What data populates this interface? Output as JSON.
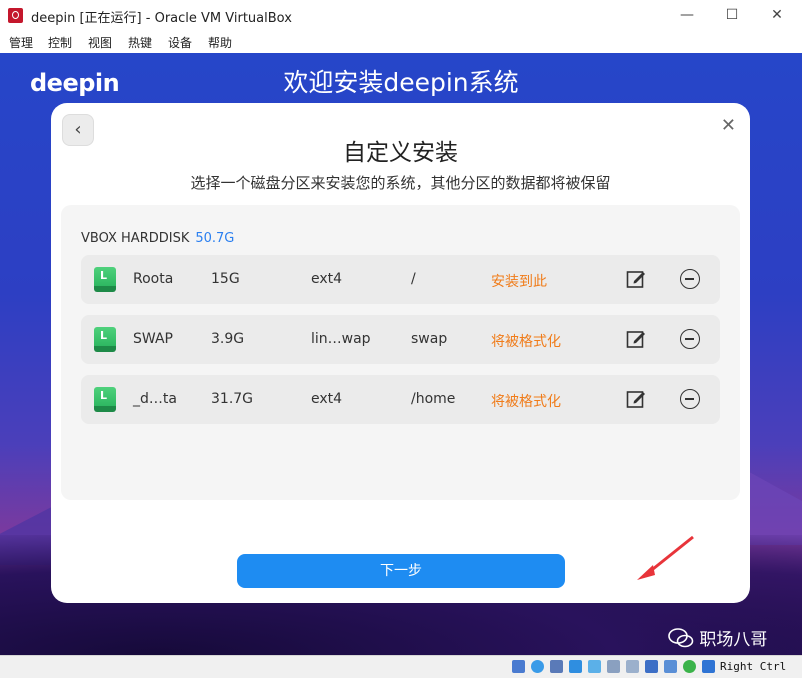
{
  "window": {
    "title": "deepin [正在运行] - Oracle VM VirtualBox",
    "minimize_glyph": "—",
    "maximize_glyph": "☐",
    "close_glyph": "✕"
  },
  "menu": [
    "管理",
    "控制",
    "视图",
    "热键",
    "设备",
    "帮助"
  ],
  "vm": {
    "logo": "deepin",
    "welcome": "欢迎安装deepin系统",
    "dialog": {
      "back_glyph": "‹",
      "close_glyph": "✕",
      "title": "自定义安装",
      "subtitle": "选择一个磁盘分区来安装您的系统，其他分区的数据都将被保留",
      "disk": {
        "name": "VBOX HARDDISK",
        "size": "50.7G"
      },
      "partitions": [
        {
          "name": "Roota",
          "size": "15G",
          "fs": "ext4",
          "mount": "/",
          "status": "安装到此"
        },
        {
          "name": "SWAP",
          "size": "3.9G",
          "fs": "lin…wap",
          "mount": "swap",
          "status": "将被格式化"
        },
        {
          "name": "_d…ta",
          "size": "31.7G",
          "fs": "ext4",
          "mount": "/home",
          "status": "将被格式化"
        }
      ],
      "next_label": "下一步"
    },
    "watermark": "职场八哥"
  },
  "statusbar": {
    "host_key": "Right Ctrl"
  },
  "colors": {
    "accent": "#1e8cf2",
    "status_orange": "#f07c1a",
    "disk_size_blue": "#2a7ff0",
    "annotation_arrow": "#e8343a"
  }
}
